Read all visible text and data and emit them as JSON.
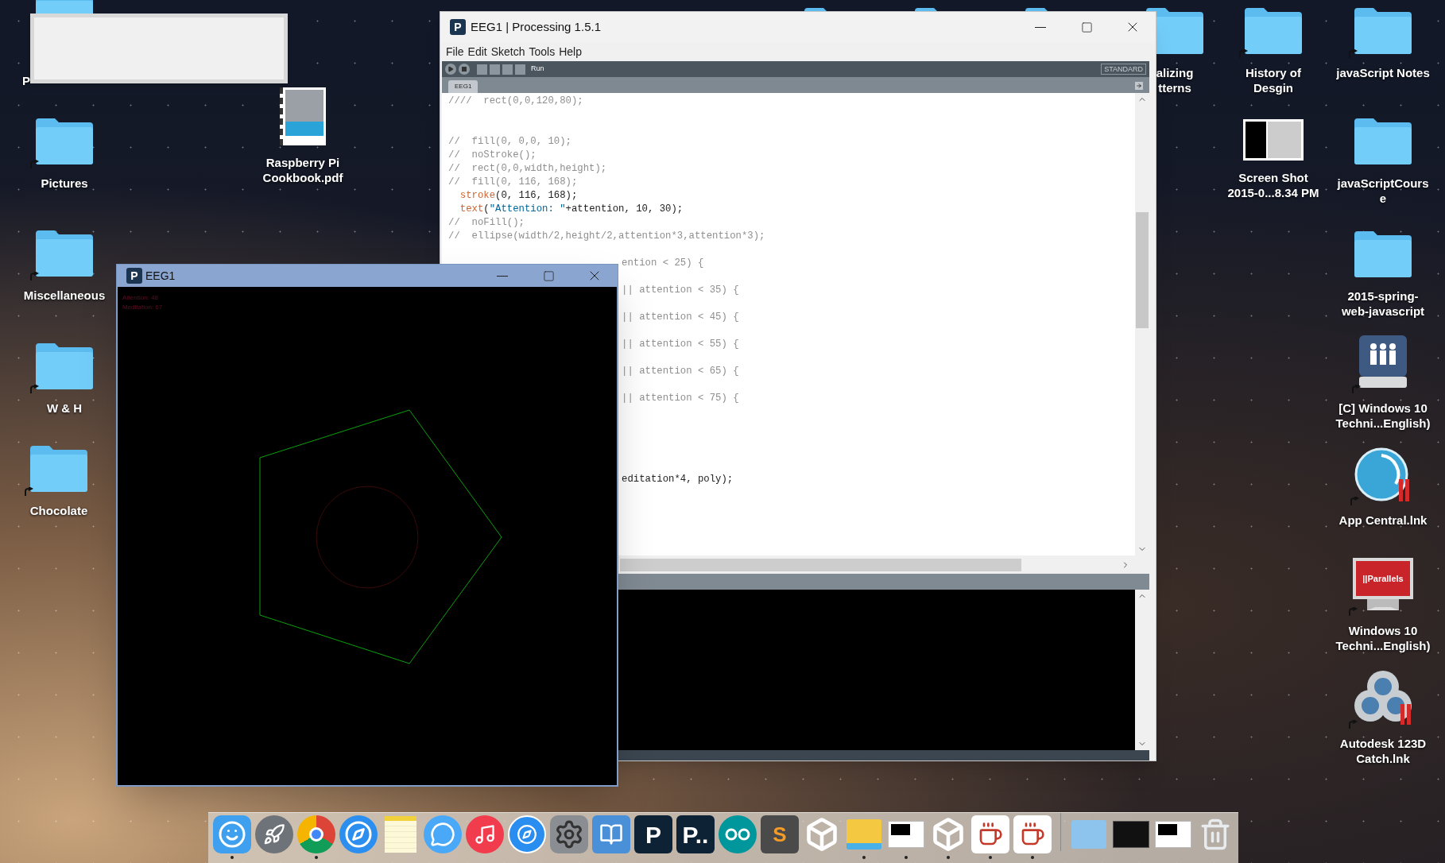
{
  "desktop_icons": [
    {
      "kind": "folder",
      "shortcut": false,
      "lines": [
        "P"
      ]
    },
    {
      "kind": "folder",
      "shortcut": true,
      "lines": [
        "Pictures"
      ]
    },
    {
      "kind": "folder",
      "shortcut": true,
      "lines": [
        "Miscellaneous"
      ]
    },
    {
      "kind": "folder",
      "shortcut": true,
      "lines": [
        "W & H"
      ]
    },
    {
      "kind": "folder",
      "shortcut": true,
      "lines": [
        "Chocolate"
      ]
    },
    {
      "kind": "pdf",
      "shortcut": false,
      "lines": [
        "Raspberry Pi",
        "Cookbook.pdf"
      ]
    },
    {
      "kind": "folder"
    },
    {
      "kind": "folder"
    },
    {
      "kind": "folder"
    },
    {
      "kind": "folder",
      "shortcut": false,
      "lines": [
        "alizing",
        "tterns"
      ]
    },
    {
      "kind": "folder",
      "shortcut": true,
      "lines": [
        "History of",
        "Desgin"
      ]
    },
    {
      "kind": "folder",
      "shortcut": true,
      "lines": [
        "javaScript Notes"
      ]
    },
    {
      "kind": "screenshot",
      "shortcut": false,
      "lines": [
        "Screen Shot",
        "2015-0...8.34 PM"
      ]
    },
    {
      "kind": "folder",
      "shortcut": false,
      "lines": [
        "javaScriptCours",
        "e"
      ]
    },
    {
      "kind": "folder",
      "shortcut": false,
      "lines": [
        "2015-spring-",
        "web-javascript"
      ]
    },
    {
      "kind": "drive",
      "shortcut": true,
      "lines": [
        "[C] Windows 10",
        "Techni...English)"
      ]
    },
    {
      "kind": "clock",
      "shortcut": true,
      "lines": [
        "App Central.lnk"
      ]
    },
    {
      "kind": "monitor",
      "shortcut": true,
      "lines": [
        "Windows 10",
        "Techni...English)"
      ],
      "brand": "||Parallels"
    },
    {
      "kind": "cluster",
      "shortcut": true,
      "lines": [
        "Autodesk 123D",
        "Catch.lnk"
      ]
    }
  ],
  "editor_window": {
    "title": "EEG1 | Processing 1.5.1",
    "app_glyph": "P",
    "menu": [
      "File",
      "Edit",
      "Sketch",
      "Tools",
      "Help"
    ],
    "run_label": "Run",
    "mode": "STANDARD",
    "tabs": [
      {
        "label": "EEG1",
        "selected": true
      }
    ],
    "code_lines": [
      {
        "kind": "comment",
        "text": "////  rect(0,0,120,80);"
      },
      {
        "kind": "blank"
      },
      {
        "kind": "blank"
      },
      {
        "kind": "comment",
        "text": "//  fill(0, 0,0, 10);"
      },
      {
        "kind": "comment",
        "text": "//  noStroke();"
      },
      {
        "kind": "comment",
        "text": "//  rect(0,0,width,height);"
      },
      {
        "kind": "comment",
        "text": "//  fill(0, 116, 168);"
      },
      {
        "kind": "code",
        "tokens": [
          {
            "kind": "keyword",
            "text": "  stroke"
          },
          {
            "kind": "plain",
            "text": "(0, 116, 168);"
          }
        ]
      },
      {
        "kind": "code",
        "tokens": [
          {
            "kind": "keyword",
            "text": "  text"
          },
          {
            "kind": "plain",
            "text": "("
          },
          {
            "kind": "string",
            "text": "\"Attention: \""
          },
          {
            "kind": "plain",
            "text": "+attention, 10, 30);"
          }
        ]
      },
      {
        "kind": "comment",
        "text": "//  noFill();"
      },
      {
        "kind": "comment",
        "text": "//  ellipse(width/2,height/2,attention*3,attention*3);"
      },
      {
        "kind": "blank"
      },
      {
        "kind": "comment",
        "covered": true,
        "text": "ention < 25) {"
      },
      {
        "kind": "blank"
      },
      {
        "kind": "comment",
        "covered": true,
        "text": "|| attention < 35) {"
      },
      {
        "kind": "blank"
      },
      {
        "kind": "comment",
        "covered": true,
        "text": "|| attention < 45) {"
      },
      {
        "kind": "blank"
      },
      {
        "kind": "comment",
        "covered": true,
        "text": "|| attention < 55) {"
      },
      {
        "kind": "blank"
      },
      {
        "kind": "comment",
        "covered": true,
        "text": "|| attention < 65) {"
      },
      {
        "kind": "blank"
      },
      {
        "kind": "comment",
        "covered": true,
        "text": "|| attention < 75) {"
      },
      {
        "kind": "blank"
      },
      {
        "kind": "blank"
      },
      {
        "kind": "blank"
      },
      {
        "kind": "blank"
      },
      {
        "kind": "blank"
      },
      {
        "kind": "code",
        "covered": true,
        "tokens": [
          {
            "kind": "plain",
            "text": "editation*4, poly);"
          }
        ]
      }
    ]
  },
  "sketch_window": {
    "title": "EEG1",
    "app_glyph": "P",
    "readouts": [
      "Attention: 48",
      "Meditation: 67"
    ]
  },
  "dock": [
    {
      "kind": "finder",
      "running": true
    },
    {
      "kind": "rocket",
      "running": false
    },
    {
      "kind": "chrome",
      "running": true
    },
    {
      "kind": "safari",
      "running": false
    },
    {
      "kind": "notes",
      "running": false
    },
    {
      "kind": "messages",
      "running": false
    },
    {
      "kind": "music",
      "running": false
    },
    {
      "kind": "appstore",
      "running": false
    },
    {
      "kind": "settings",
      "running": false
    },
    {
      "kind": "dictionary",
      "running": false
    },
    {
      "kind": "processing",
      "running": false,
      "glyph": "P"
    },
    {
      "kind": "processing",
      "running": false,
      "glyph": "P.."
    },
    {
      "kind": "arduino",
      "running": false
    },
    {
      "kind": "sublime",
      "running": false,
      "glyph": "S"
    },
    {
      "kind": "unity",
      "running": false
    },
    {
      "kind": "explorer",
      "running": true
    },
    {
      "kind": "window",
      "running": true
    },
    {
      "kind": "unity",
      "running": true
    },
    {
      "kind": "java",
      "running": true
    },
    {
      "kind": "java",
      "running": true
    },
    {
      "kind": "separator"
    },
    {
      "kind": "winfolder",
      "running": false
    },
    {
      "kind": "darkthumb",
      "running": false
    },
    {
      "kind": "window",
      "running": false
    },
    {
      "kind": "trash",
      "running": false
    }
  ]
}
